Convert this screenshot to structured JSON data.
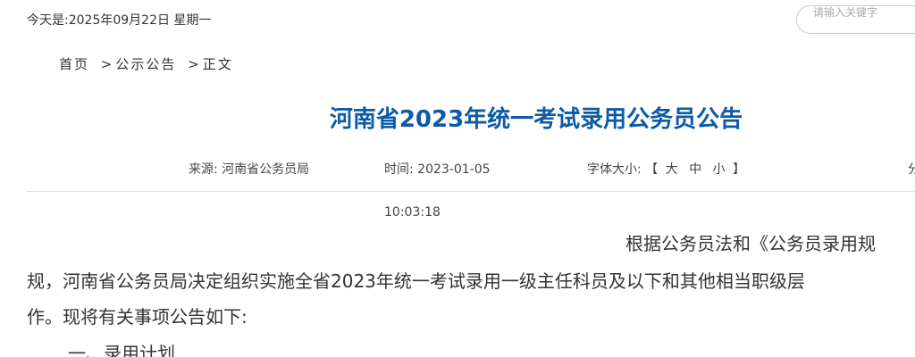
{
  "header": {
    "date_text": "今天是:2025年09月22日 星期一",
    "search_placeholder": "请输入关键字"
  },
  "breadcrumb": {
    "items": [
      "首页",
      "公示公告",
      "正文"
    ],
    "separator": ">"
  },
  "article": {
    "title": "河南省2023年统一考试录用公务员公告",
    "source_label": "来源:",
    "source_value": "河南省公务员局",
    "time_label": "时间:",
    "date_value": "2023-01-05",
    "time_value": "10:03:18",
    "fontsize_label": "字体大小:",
    "fontsize_open": "【",
    "fontsize_large": "大",
    "fontsize_medium": "中",
    "fontsize_small": "小",
    "fontsize_close": "】",
    "share_partial": "分",
    "paragraphs": [
      "根据公务员法和《公务员录用规",
      "规，河南省公务员局决定组织实施全省2023年统一考试录用一级主任科员及以下和其他相当职级层",
      "作。现将有关事项公告如下:",
      "一、录用计划"
    ]
  },
  "colors": {
    "title": "#0d5ba6",
    "text": "#333333",
    "divider": "#dddddd"
  }
}
